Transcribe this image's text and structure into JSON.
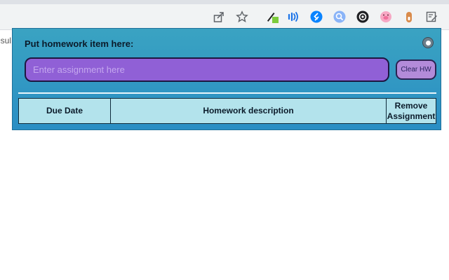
{
  "browser": {
    "toolbar_icons": [
      {
        "name": "share-icon"
      },
      {
        "name": "bookmark-star-icon"
      },
      {
        "name": "eyedropper-extension-icon"
      },
      {
        "name": "audio-extension-icon"
      },
      {
        "name": "shazam-extension-icon"
      },
      {
        "name": "search-extension-icon"
      },
      {
        "name": "record-extension-icon"
      },
      {
        "name": "pig-extension-icon"
      },
      {
        "name": "dropper-extension-icon"
      },
      {
        "name": "homework-extension-icon"
      }
    ],
    "page_edge_text": "esul"
  },
  "popup": {
    "title": "Put homework item here:",
    "input": {
      "placeholder": "Enter assignment here",
      "value": ""
    },
    "clear_label": "Clear HW",
    "close_icon": "close-circle-icon",
    "table": {
      "headers": [
        "Due Date",
        "Homework description",
        "Remove Assignment"
      ]
    }
  },
  "colors": {
    "popup_bg": "#2f9bc4",
    "input_bg": "#9060d6",
    "clear_bg": "#b38bd9",
    "table_header_bg": "#b3e3ec"
  }
}
